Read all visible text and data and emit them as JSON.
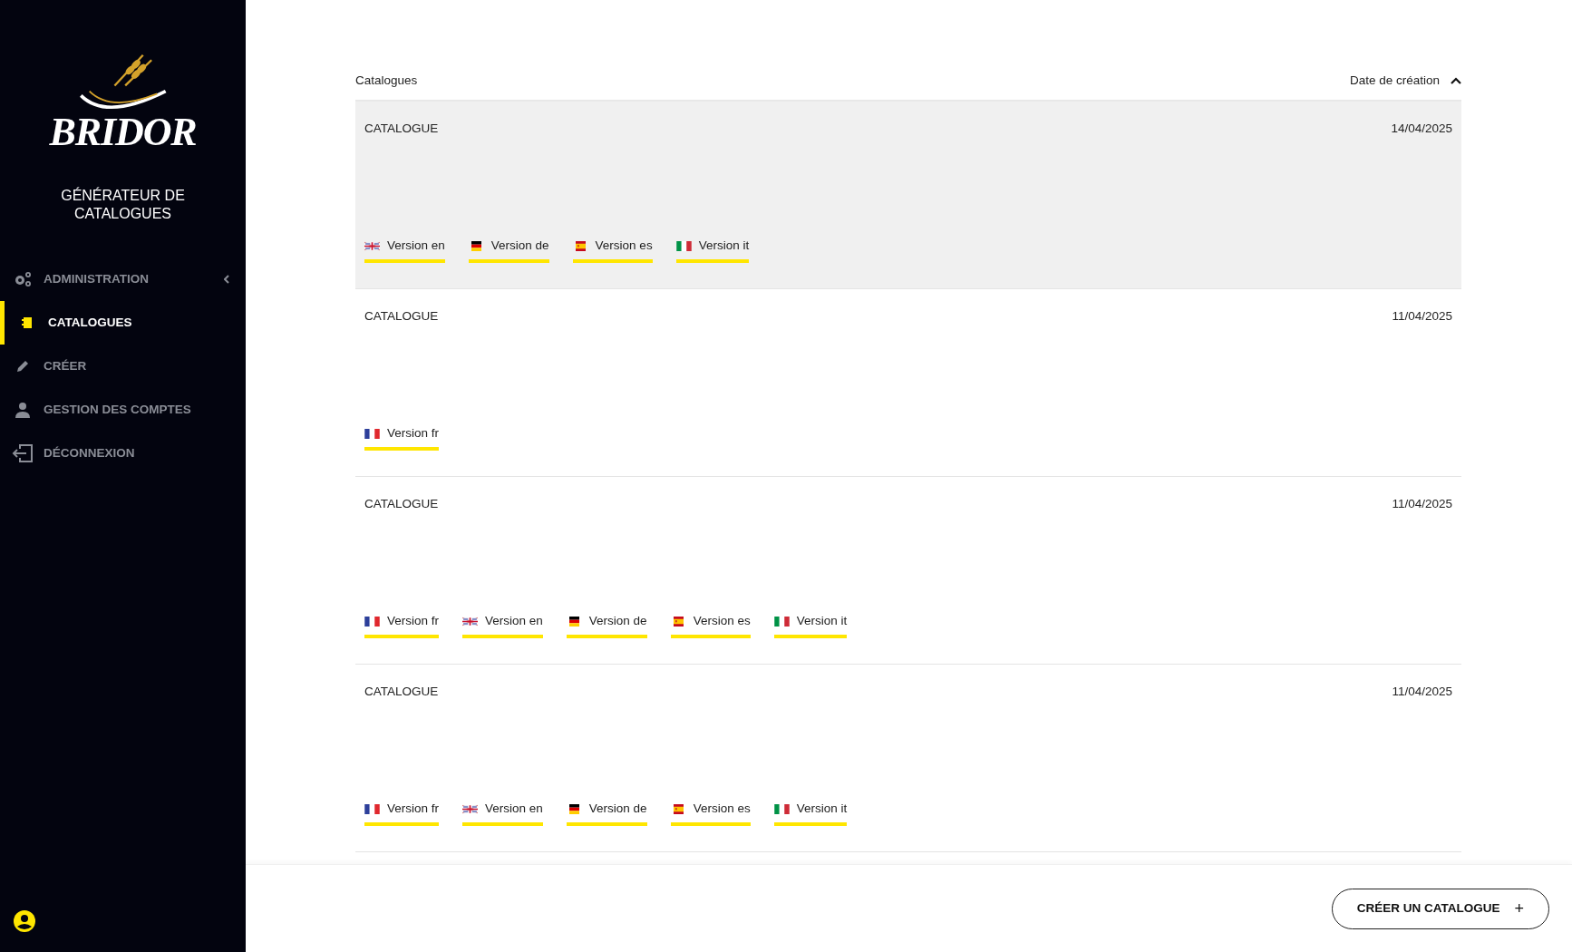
{
  "sidebar": {
    "logo": "BRIDOR",
    "subtitle": "GÉNÉRATEUR DE CATALOGUES",
    "items": [
      {
        "label": "ADMINISTRATION",
        "kind": "gears",
        "selected": false,
        "expanded": false
      },
      {
        "label": "CATALOGUES",
        "kind": "book",
        "selected": true
      },
      {
        "label": "CRÉER",
        "kind": "pencil",
        "selected": false
      },
      {
        "label": "GESTION DES COMPTES",
        "kind": "person",
        "selected": false
      },
      {
        "label": "DÉCONNEXION",
        "kind": "logout",
        "selected": false
      }
    ]
  },
  "list": {
    "title": "Catalogues",
    "sort_label": "Date de création",
    "sort_ascending": true,
    "rows": [
      {
        "name": "CATALOGUE",
        "date": "14/04/2025",
        "highlighted": true,
        "versions": [
          {
            "label": "Version en",
            "kind": "en"
          },
          {
            "label": "Version de",
            "kind": "de"
          },
          {
            "label": "Version es",
            "kind": "es"
          },
          {
            "label": "Version it",
            "kind": "it"
          }
        ]
      },
      {
        "name": "CATALOGUE",
        "date": "11/04/2025",
        "highlighted": false,
        "versions": [
          {
            "label": "Version fr",
            "kind": "fr"
          }
        ]
      },
      {
        "name": "CATALOGUE",
        "date": "11/04/2025",
        "highlighted": false,
        "versions": [
          {
            "label": "Version fr",
            "kind": "fr"
          },
          {
            "label": "Version en",
            "kind": "en"
          },
          {
            "label": "Version de",
            "kind": "de"
          },
          {
            "label": "Version es",
            "kind": "es"
          },
          {
            "label": "Version it",
            "kind": "it"
          }
        ]
      },
      {
        "name": "CATALOGUE",
        "date": "11/04/2025",
        "highlighted": false,
        "versions": [
          {
            "label": "Version fr",
            "kind": "fr"
          },
          {
            "label": "Version en",
            "kind": "en"
          },
          {
            "label": "Version de",
            "kind": "de"
          },
          {
            "label": "Version es",
            "kind": "es"
          },
          {
            "label": "Version it",
            "kind": "it"
          }
        ]
      }
    ]
  },
  "footer": {
    "create_button": "CRÉER UN CATALOGUE",
    "create_icon": "+"
  }
}
